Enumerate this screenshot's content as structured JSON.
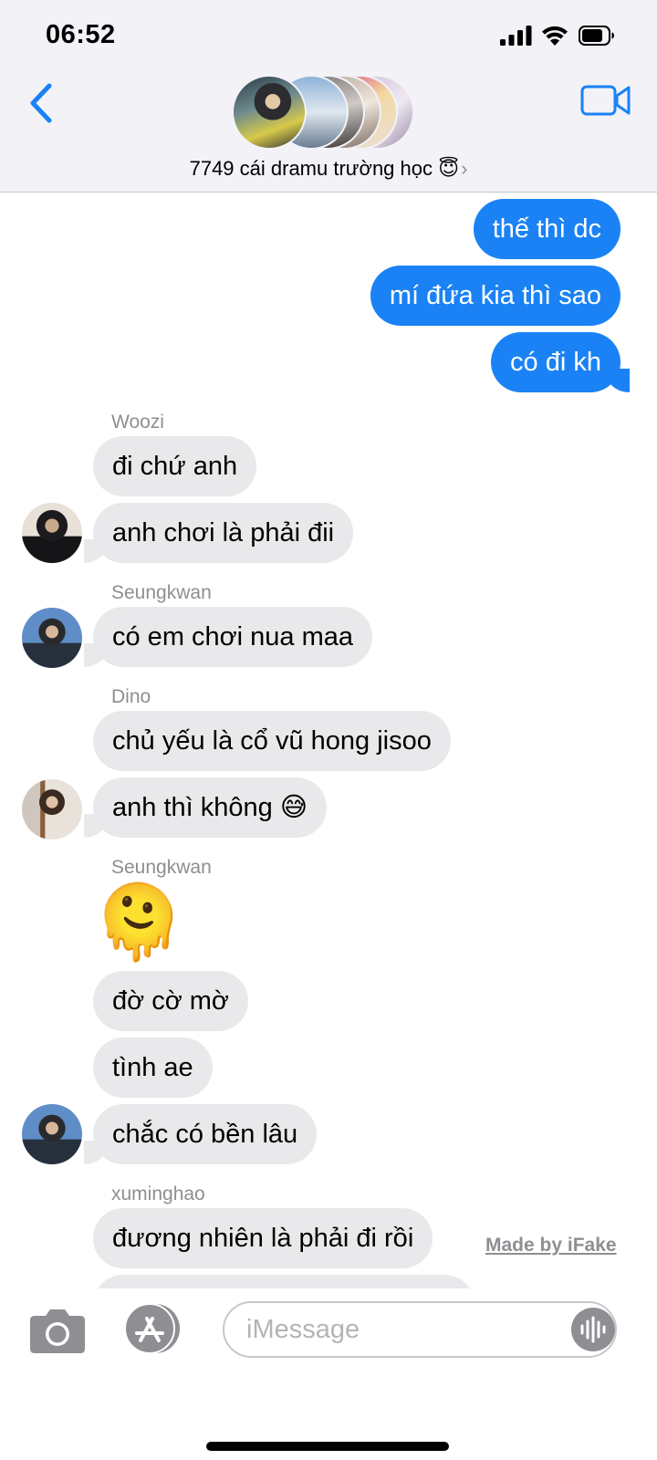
{
  "status_bar": {
    "time": "06:52"
  },
  "header": {
    "group_name": "7749 cái dramu trường học",
    "group_emoji": "😇",
    "chevron": "›"
  },
  "messages": [
    {
      "dir": "out",
      "text": "thế thì dc"
    },
    {
      "dir": "out",
      "text": "mí đứa kia thì sao"
    },
    {
      "dir": "out",
      "text": "có đi kh"
    },
    {
      "dir": "in",
      "sender": "Woozi",
      "text": "đi chứ anh"
    },
    {
      "dir": "in",
      "text": "anh chơi là phải đii"
    },
    {
      "dir": "in",
      "sender": "Seungkwan",
      "text": "có em chơi nua maa"
    },
    {
      "dir": "in",
      "sender": "Dino",
      "text": "chủ yếu là cổ vũ hong jisoo"
    },
    {
      "dir": "in",
      "text": "anh thì không 😅"
    },
    {
      "dir": "in",
      "sender": "Seungkwan",
      "text": "🫠"
    },
    {
      "dir": "in",
      "text": "đờ cờ mờ"
    },
    {
      "dir": "in",
      "text": "tình ae"
    },
    {
      "dir": "in",
      "text": "chắc có bền lâu"
    },
    {
      "dir": "in",
      "sender": "xuminghao",
      "text": "đương nhiên là phải đi rồi"
    }
  ],
  "watermark": "Made by iFake",
  "composer": {
    "placeholder": "iMessage"
  },
  "icons": {
    "back": "chevron-left-icon",
    "video": "video-camera-icon",
    "camera": "camera-icon",
    "appstore": "app-store-icon",
    "voice": "waveform-icon"
  },
  "colors": {
    "outgoing_bubble": "#1a82f5",
    "incoming_bubble": "#e9e9eb",
    "accent": "#1a82f5",
    "header_bg": "#f2f2f7"
  }
}
